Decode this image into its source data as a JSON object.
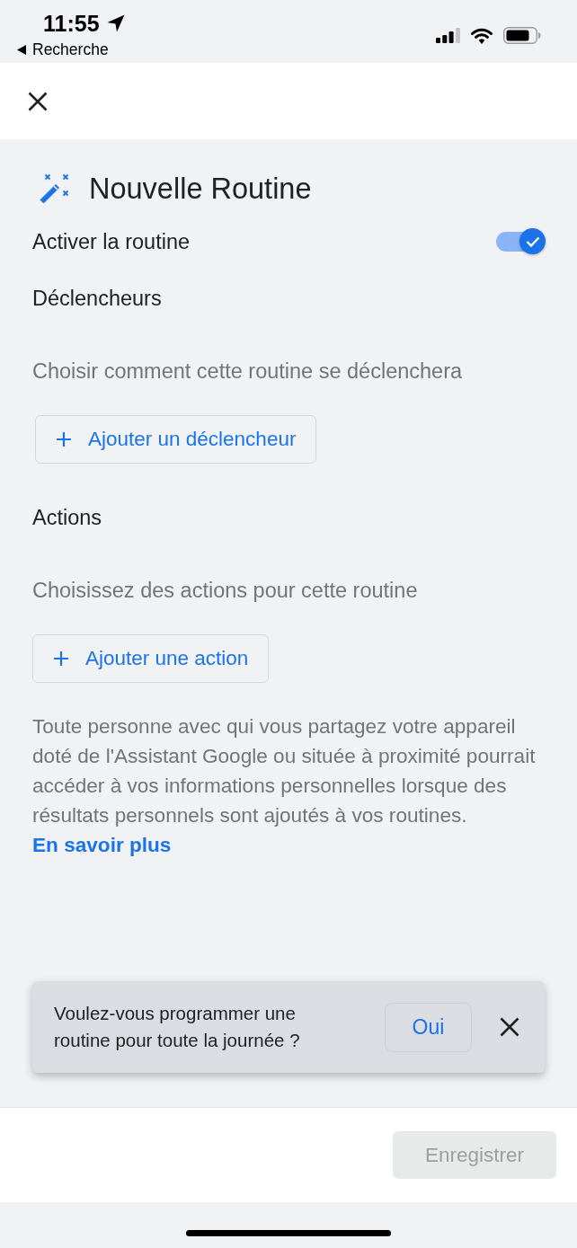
{
  "status_bar": {
    "time": "11:55",
    "back_label": "Recherche"
  },
  "routine": {
    "title": "Nouvelle Routine",
    "enable": {
      "label": "Activer la routine",
      "on": true
    },
    "sections": [
      {
        "heading": "Déclencheurs",
        "hint": "Choisir comment cette routine se déclenchera",
        "button": "Ajouter un déclencheur"
      },
      {
        "heading": "Actions",
        "hint": "Choisissez des actions pour cette routine",
        "button": "Ajouter une action"
      }
    ],
    "notice": {
      "text": "Toute personne avec qui vous partagez votre appareil doté de l'Assistant Google ou située à proximité pourrait accéder à vos informations personnelles lorsque des résultats personnels sont ajoutés à vos routines.",
      "link": "En savoir plus"
    }
  },
  "snackbar": {
    "message": "Voulez-vous programmer une routine pour toute la journée ?",
    "action": "Oui"
  },
  "footer": {
    "save_button": {
      "label": "Enregistrer",
      "disabled": true
    }
  }
}
